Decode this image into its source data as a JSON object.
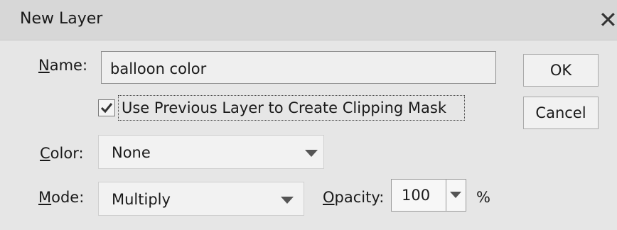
{
  "dialog": {
    "title": "New Layer",
    "close_icon": "close-icon"
  },
  "name": {
    "label_mnemonic": "N",
    "label_rest": "ame:",
    "value": "balloon color"
  },
  "clipping": {
    "checked": true,
    "label": "Use Previous Layer to Create Clipping Mask"
  },
  "color": {
    "label_mnemonic": "C",
    "label_rest": "olor:",
    "selected": "None"
  },
  "mode": {
    "label_mnemonic": "M",
    "label_rest": "ode:",
    "selected": "Multiply"
  },
  "opacity": {
    "label_mnemonic": "O",
    "label_rest": "pacity:",
    "value": "100",
    "unit": "%"
  },
  "buttons": {
    "ok": "OK",
    "cancel": "Cancel"
  }
}
